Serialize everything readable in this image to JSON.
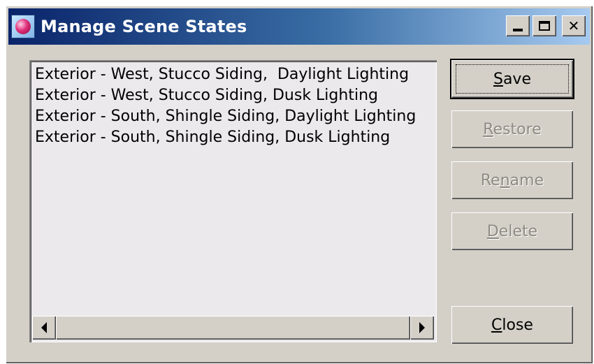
{
  "window": {
    "title": "Manage Scene States",
    "icon": "scene-states-app-icon"
  },
  "list": {
    "items": [
      "Exterior - West, Stucco Siding,  Daylight Lighting",
      "Exterior - West, Stucco Siding, Dusk Lighting",
      "Exterior - South, Shingle Siding, Daylight Lighting",
      "Exterior - South, Shingle Siding, Dusk Lighting"
    ]
  },
  "buttons": {
    "save": {
      "pre": "",
      "accel": "S",
      "post": "ave",
      "enabled": true
    },
    "restore": {
      "pre": "",
      "accel": "R",
      "post": "estore",
      "enabled": false
    },
    "rename": {
      "pre": "Re",
      "accel": "n",
      "post": "ame",
      "enabled": false
    },
    "delete": {
      "pre": "",
      "accel": "D",
      "post": "elete",
      "enabled": false
    },
    "close": {
      "pre": "",
      "accel": "C",
      "post": "lose",
      "enabled": true
    }
  }
}
